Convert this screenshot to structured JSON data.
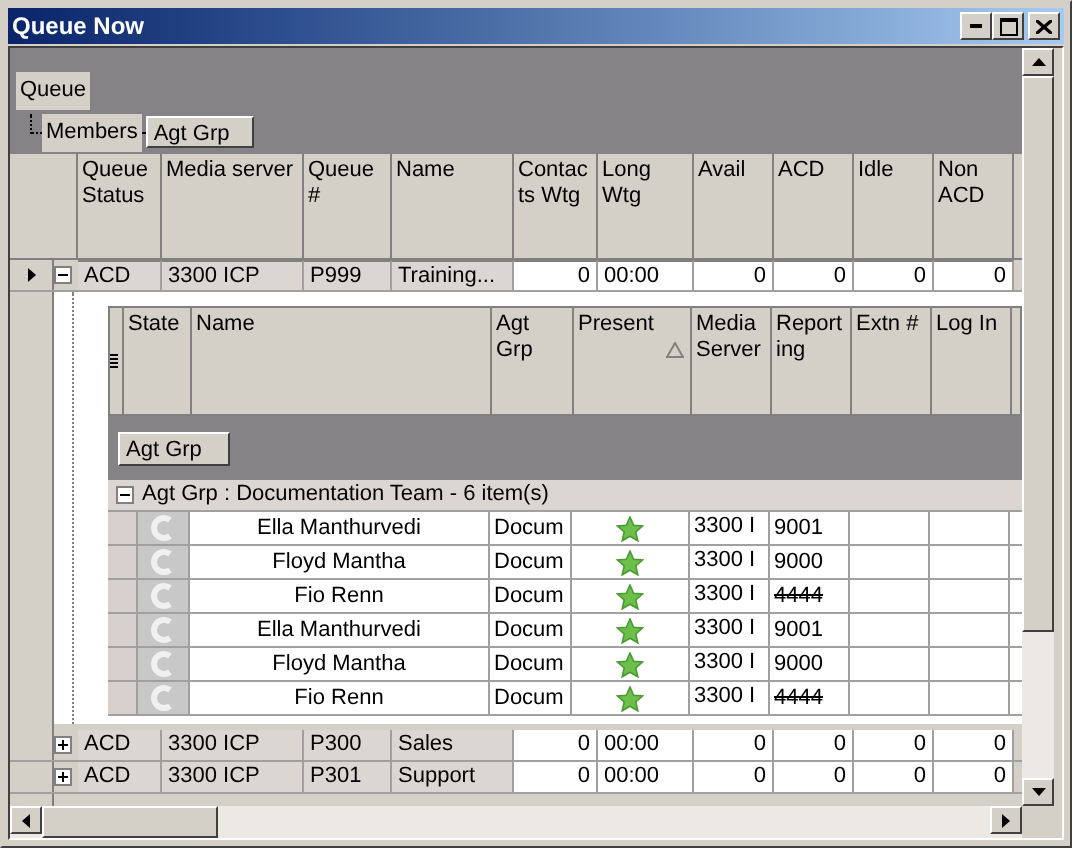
{
  "window": {
    "title": "Queue Now"
  },
  "band_tree": {
    "root": "Queue",
    "child": "Members",
    "leaf": "Agt Grp"
  },
  "queue_table": {
    "columns": [
      "Queue Status",
      "Media server",
      "Queue #",
      "Name",
      "Contacts Wtg",
      "Long Wtg",
      "Avail",
      "ACD",
      "Idle",
      "Non ACD"
    ],
    "rows": [
      {
        "current": true,
        "expanded": true,
        "cells": [
          "ACD",
          "3300 ICP",
          "P999",
          "Training...",
          "0",
          "00:00",
          "0",
          "0",
          "0",
          "0"
        ]
      },
      {
        "current": false,
        "expanded": false,
        "cells": [
          "ACD",
          "3300 ICP",
          "P300",
          "Sales",
          "0",
          "00:00",
          "0",
          "0",
          "0",
          "0"
        ]
      },
      {
        "current": false,
        "expanded": false,
        "cells": [
          "ACD",
          "3300 ICP",
          "P301",
          "Support",
          "0",
          "00:00",
          "0",
          "0",
          "0",
          "0"
        ]
      }
    ]
  },
  "members_table": {
    "columns": [
      {
        "label": "State",
        "sorted": false
      },
      {
        "label": "Name",
        "sorted": false
      },
      {
        "label": "Agt Grp",
        "sorted": false
      },
      {
        "label": "Present",
        "sorted": true
      },
      {
        "label": "Media Server",
        "sorted": false
      },
      {
        "label": "Reporting",
        "sorted": false
      },
      {
        "label": "Extn #",
        "sorted": false
      },
      {
        "label": "Log In",
        "sorted": false
      }
    ],
    "group_band": "Agt Grp",
    "group": {
      "label": "Agt Grp : Documentation Team - 6 item(s)",
      "expanded": true
    },
    "rows": [
      {
        "name": "Ella Manthurvedi",
        "agt_grp": "Docum",
        "present": true,
        "media_server": "3300 I",
        "reporting": "9001",
        "struck": false
      },
      {
        "name": "Floyd Mantha",
        "agt_grp": "Docum",
        "present": true,
        "media_server": "3300 I",
        "reporting": "9000",
        "struck": false
      },
      {
        "name": "Fio Renn",
        "agt_grp": "Docum",
        "present": true,
        "media_server": "3300 I",
        "reporting": "4444",
        "struck": true
      },
      {
        "name": "Ella Manthurvedi",
        "agt_grp": "Docum",
        "present": true,
        "media_server": "3300 I",
        "reporting": "9001",
        "struck": false
      },
      {
        "name": "Floyd Mantha",
        "agt_grp": "Docum",
        "present": true,
        "media_server": "3300 I",
        "reporting": "9000",
        "struck": false
      },
      {
        "name": "Fio Renn",
        "agt_grp": "Docum",
        "present": true,
        "media_server": "3300 I",
        "reporting": "4444",
        "struck": true
      }
    ]
  }
}
